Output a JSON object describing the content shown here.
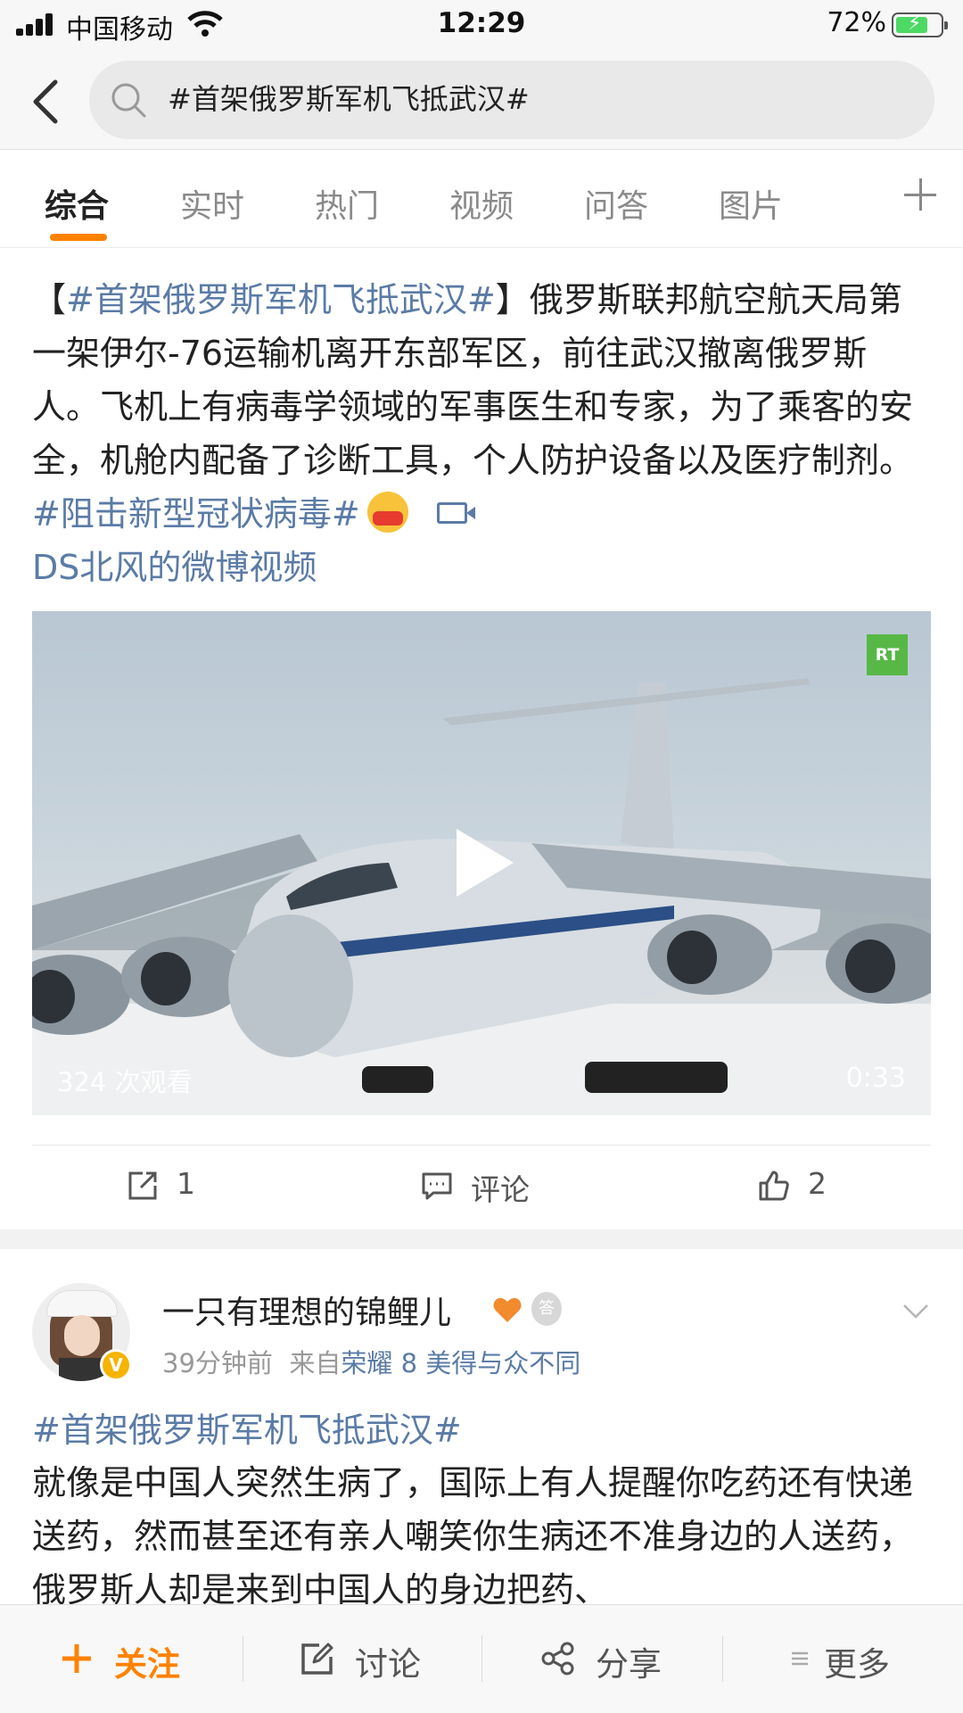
{
  "status_bar": {
    "carrier": "中国移动",
    "time": "12:29",
    "battery": "72%",
    "battery_level": 0.72
  },
  "search": {
    "query": "#首架俄罗斯军机飞抵武汉#"
  },
  "tabs": [
    {
      "label": "综合",
      "active": true
    },
    {
      "label": "实时",
      "active": false
    },
    {
      "label": "热门",
      "active": false
    },
    {
      "label": "视频",
      "active": false
    },
    {
      "label": "问答",
      "active": false
    },
    {
      "label": "图片",
      "active": false
    }
  ],
  "post1": {
    "open_bracket": "【",
    "hashtag": "#首架俄罗斯军机飞抵武汉#",
    "text": "】俄罗斯联邦航空航天局第一架伊尔-76运输机离开东部军区，前往武汉撤离俄罗斯人。飞机上有病毒学领域的军事医生和专家，为了乘客的安全，机舱内配备了诊断工具，个人防护设备以及医疗制剂。",
    "hashtag2": "#阻击新型冠状病毒#",
    "link": "DS北风的微博视频",
    "video": {
      "logo": "RT",
      "views": "324 次观看",
      "duration": "0:33"
    },
    "actions": {
      "repost": "1",
      "comment": "评论",
      "like": "2"
    }
  },
  "post2": {
    "username": "一只有理想的锦鲤儿",
    "badge_text": "V",
    "time": "39分钟前",
    "source_prefix": "来自",
    "source": "荣耀 8 美得与众不同",
    "hashtag": "#首架俄罗斯军机飞抵武汉#",
    "text": "就像是中国人突然生病了，国际上有人提醒你吃药还有快递送药，然而甚至还有亲人嘲笑你生病还不准身边的人送药，俄罗斯人却是来到中国人的身边把药、"
  },
  "bottom_bar": {
    "follow": "关注",
    "discuss": "讨论",
    "share": "分享",
    "more": "更多"
  },
  "colors": {
    "accent": "#ff8200",
    "link": "#5b7ba6"
  },
  "icons": [
    "signal-icon",
    "wifi-icon",
    "battery-icon",
    "back-icon",
    "search-icon",
    "plus-icon",
    "video-link-icon",
    "play-icon",
    "repost-icon",
    "comment-icon",
    "like-icon",
    "verified-icon",
    "heart-icon",
    "medal-icon",
    "chevron-down-icon",
    "follow-plus-icon",
    "edit-icon",
    "share-icon",
    "more-icon"
  ]
}
